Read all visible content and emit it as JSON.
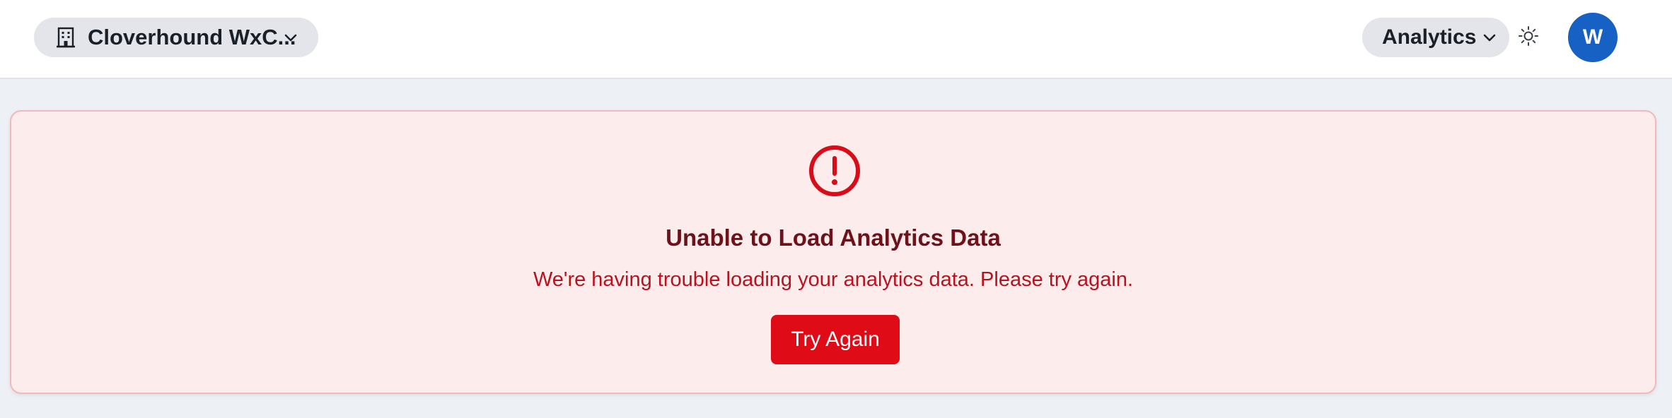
{
  "header": {
    "org_switcher": {
      "label": "Cloverhound WxC...",
      "icon": "building-icon"
    },
    "view_switcher": {
      "label": "Analytics",
      "icon": "chevron-down-icon"
    },
    "theme_toggle": {
      "icon": "sun-icon"
    },
    "avatar": {
      "initial": "W",
      "color": "#1760c4"
    }
  },
  "error": {
    "icon": "alert-circle-icon",
    "title": "Unable to Load Analytics Data",
    "message": "We're having trouble loading your analytics data. Please try again.",
    "retry_label": "Try Again",
    "colors": {
      "background": "#fcecec",
      "border": "#f2b8ba",
      "title": "#6e111b",
      "message": "#b8121f",
      "button": "#df0b16"
    }
  }
}
